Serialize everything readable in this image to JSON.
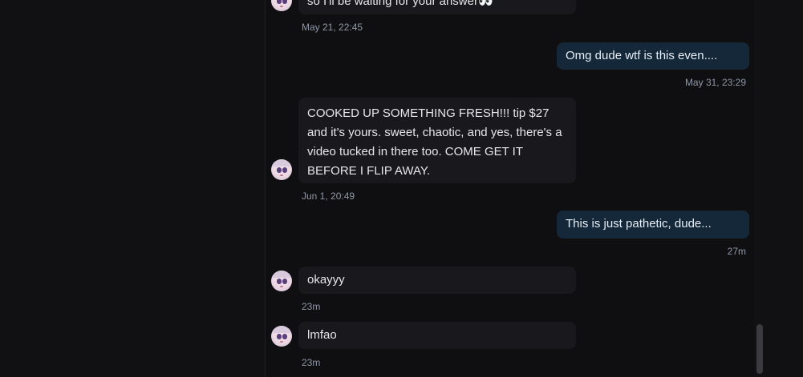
{
  "messages": [
    {
      "dir": "in",
      "text": "so I'll be waiting for your answer👀",
      "time": "May 21, 22:45"
    },
    {
      "dir": "out",
      "text": "Omg dude wtf is this even....",
      "time": "May 31, 23:29"
    },
    {
      "dir": "in",
      "text": "COOKED UP SOMETHING FRESH!!! tip $27 and it's yours. sweet, chaotic, and yes, there's a video tucked in there too. COME GET IT BEFORE I FLIP AWAY.",
      "time": "Jun 1, 20:49"
    },
    {
      "dir": "out",
      "text": "This is just pathetic, dude...",
      "time": "27m"
    },
    {
      "dir": "in",
      "text": "okayyy",
      "time": "23m"
    },
    {
      "dir": "in",
      "text": "lmfao",
      "time": "23m"
    }
  ],
  "avatar_icon": "anime-avatar-icon"
}
